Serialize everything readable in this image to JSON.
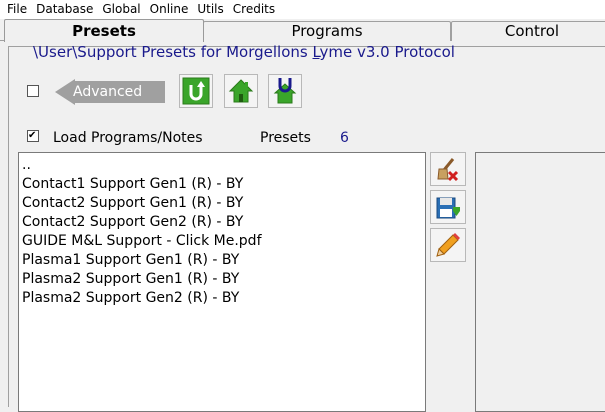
{
  "menu": [
    "File",
    "Database",
    "Global",
    "Online",
    "Utils",
    "Credits"
  ],
  "tabs": [
    {
      "label": "Presets",
      "active": true
    },
    {
      "label": "Programs",
      "active": false
    },
    {
      "label": "Control",
      "active": false
    }
  ],
  "path": {
    "prefix": "\\User\\Support Presets for Morgellons ",
    "underlined_letter": "L",
    "suffix": "yme v3.0 Protocol"
  },
  "advanced": {
    "label": "Advanced",
    "checked": false
  },
  "toolbar_icons": [
    "refresh-arrow-icon",
    "home-icon",
    "home-u-icon"
  ],
  "load_programs": {
    "label": "Load Programs/Notes",
    "checked": true
  },
  "presets": {
    "label": "Presets",
    "count": "6"
  },
  "list_items": [
    "..",
    "Contact1 Support Gen1 (R) - BY",
    "Contact2 Support Gen1 (R) - BY",
    "Contact2 Support Gen2 (R) - BY",
    "GUIDE M&L Support - Click Me.pdf",
    "Plasma1 Support Gen1 (R) - BY",
    "Plasma2 Support Gen1 (R) - BY",
    "Plasma2 Support Gen2 (R) - BY"
  ],
  "side_buttons": [
    "broom-delete-icon",
    "save-disk-icon",
    "pencil-edit-icon"
  ],
  "colors": {
    "path_text": "#1a1a8c",
    "count_text": "#1a1a8c",
    "arrow_gray": "#a0a0a0",
    "icon_green": "#3aa52a"
  }
}
